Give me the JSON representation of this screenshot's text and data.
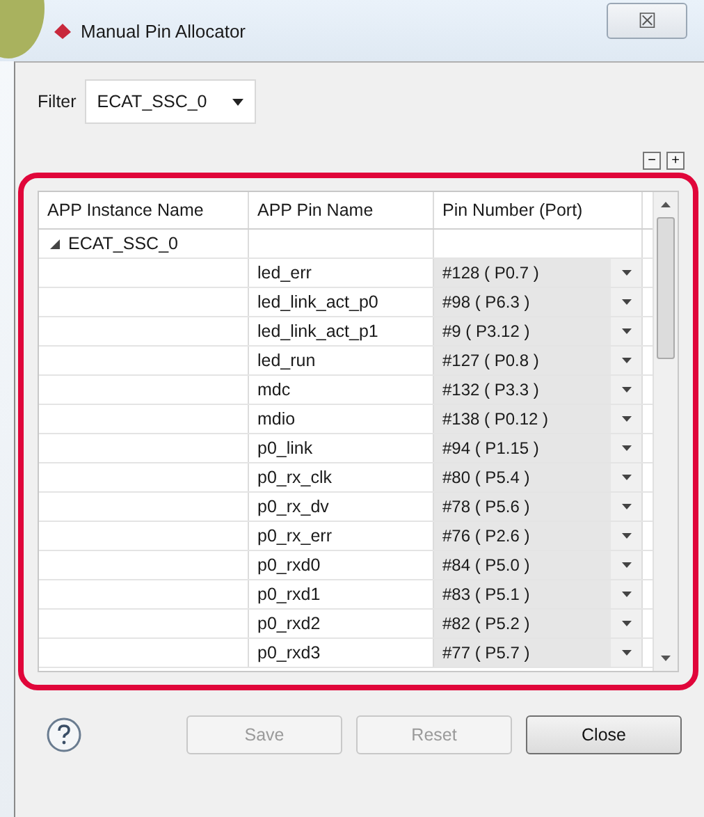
{
  "window": {
    "title": "Manual Pin Allocator",
    "close_symbol": "☒"
  },
  "filter": {
    "label": "Filter",
    "value": "ECAT_SSC_0"
  },
  "tree_controls": [
    "−",
    "+"
  ],
  "table": {
    "columns": [
      "APP Instance Name",
      "APP Pin Name",
      "Pin Number (Port)"
    ],
    "group": {
      "name": "ECAT_SSC_0",
      "expanded": true,
      "children": [
        {
          "pin": "led_err",
          "port": "#128 ( P0.7 )"
        },
        {
          "pin": "led_link_act_p0",
          "port": "#98 ( P6.3 )"
        },
        {
          "pin": "led_link_act_p1",
          "port": "#9 ( P3.12 )"
        },
        {
          "pin": "led_run",
          "port": "#127 ( P0.8 )"
        },
        {
          "pin": "mdc",
          "port": "#132 ( P3.3 )"
        },
        {
          "pin": "mdio",
          "port": "#138 ( P0.12 )"
        },
        {
          "pin": "p0_link",
          "port": "#94 ( P1.15 )"
        },
        {
          "pin": "p0_rx_clk",
          "port": "#80 ( P5.4 )"
        },
        {
          "pin": "p0_rx_dv",
          "port": "#78 ( P5.6 )"
        },
        {
          "pin": "p0_rx_err",
          "port": "#76 ( P2.6 )"
        },
        {
          "pin": "p0_rxd0",
          "port": "#84 ( P5.0 )"
        },
        {
          "pin": "p0_rxd1",
          "port": "#83 ( P5.1 )"
        },
        {
          "pin": "p0_rxd2",
          "port": "#82 ( P5.2 )"
        },
        {
          "pin": "p0_rxd3",
          "port": "#77 ( P5.7 )"
        }
      ]
    }
  },
  "buttons": [
    {
      "label": "Save",
      "disabled": true
    },
    {
      "label": "Reset",
      "disabled": true
    },
    {
      "label": "Close",
      "disabled": false
    }
  ]
}
